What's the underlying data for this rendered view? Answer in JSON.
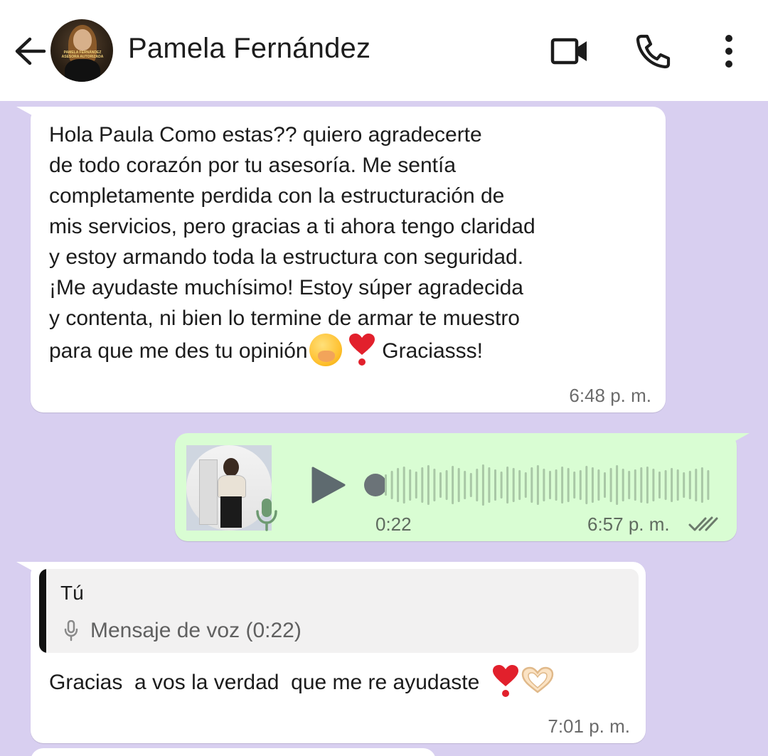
{
  "header": {
    "contact_name": "Pamela Fernández",
    "avatar_text": "PAMELA FERNÁNDEZ ASESORA AUTORIZADA",
    "icons": [
      "back-arrow-icon",
      "video-call-icon",
      "phone-icon",
      "more-vert-icon"
    ]
  },
  "messages": [
    {
      "direction": "incoming",
      "text": "Hola Paula Como estas??  quiero agradecerte\nde todo corazón por tu asesoría. Me sentía\ncompletamente perdida con la estructuración de\nmis servicios, pero gracias a ti ahora tengo claridad\ny estoy armando toda la estructura con seguridad.\n¡Me ayudaste muchísimo! Estoy súper agradecida\ny contenta, ni bien lo termine de armar te muestro\npara que me des tu opinión",
      "text_end": "Graciasss!",
      "time": "6:48 p. m."
    },
    {
      "direction": "outgoing",
      "type": "voice",
      "duration": "0:22",
      "time": "6:57 p. m.",
      "status": "read"
    },
    {
      "direction": "incoming",
      "quote_author": "Tú",
      "quote_text": "Mensaje de voz (0:22)",
      "text": "Gracias  a vos la verdad  que me re ayudaste",
      "time": "7:01 p. m."
    }
  ],
  "colors": {
    "chat_background": "#d8cff0",
    "incoming_bubble": "#ffffff",
    "outgoing_bubble": "#d9fdd3",
    "heart": "#e2202c"
  }
}
